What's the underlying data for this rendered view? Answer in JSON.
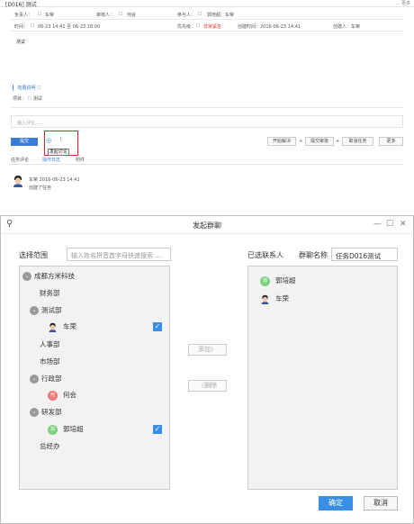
{
  "task_panel": {
    "title": "[D016] 测试",
    "top_right": "... 更多",
    "row1": {
      "owner": "负责人：",
      "owner_value": "车荣",
      "reviewer": "审核人：",
      "reviewer_value": "何会",
      "participants": "参与人：",
      "participants_value": "郭培超、车荣"
    },
    "row2": {
      "time": "时间：",
      "time_value": "06-23 14:41 至 06-23 18:00",
      "priority": "优先级：",
      "priority_value": "非常紧急",
      "created": "创建时间：2016-06-23 14:41",
      "creator": "创建人：车荣"
    },
    "description": "测试",
    "extra_label": "拓展说明",
    "project": "项目：",
    "project_value": "测试",
    "comment_placeholder": "输入评论......",
    "submit": "提交",
    "tooltip": "发起讨论",
    "actions": [
      "开始解决",
      "提交审批",
      "取消任务",
      "更多"
    ],
    "tabs": [
      "任务评论",
      "操作日志",
      "附件"
    ],
    "log": {
      "meta": "车荣    2016-06-23 14:41",
      "text": "创建了任务"
    }
  },
  "modal": {
    "title": "发起群聊",
    "controls": {
      "minimize": "—",
      "maximize": "☐",
      "close": "✕"
    },
    "scope_label": "选择范围",
    "search_placeholder": "输入姓名拼音首字母快速搜索.....",
    "selected_label": "已选联系人",
    "group_name_label": "群聊名称",
    "group_name_value": "任务D016测试",
    "tree": {
      "root": "成都方米科技",
      "finance": "财务部",
      "test": "测试部",
      "test_member": "车荣",
      "hr": "人事部",
      "market": "市场部",
      "admin": "行政部",
      "admin_member": "何会",
      "dev": "研发部",
      "dev_member": "郭培超",
      "gm": "总经办"
    },
    "selected": [
      "郭培超",
      "车荣"
    ],
    "add": "添加〉",
    "remove": "〈删除",
    "ok": "确定",
    "cancel": "取消"
  }
}
